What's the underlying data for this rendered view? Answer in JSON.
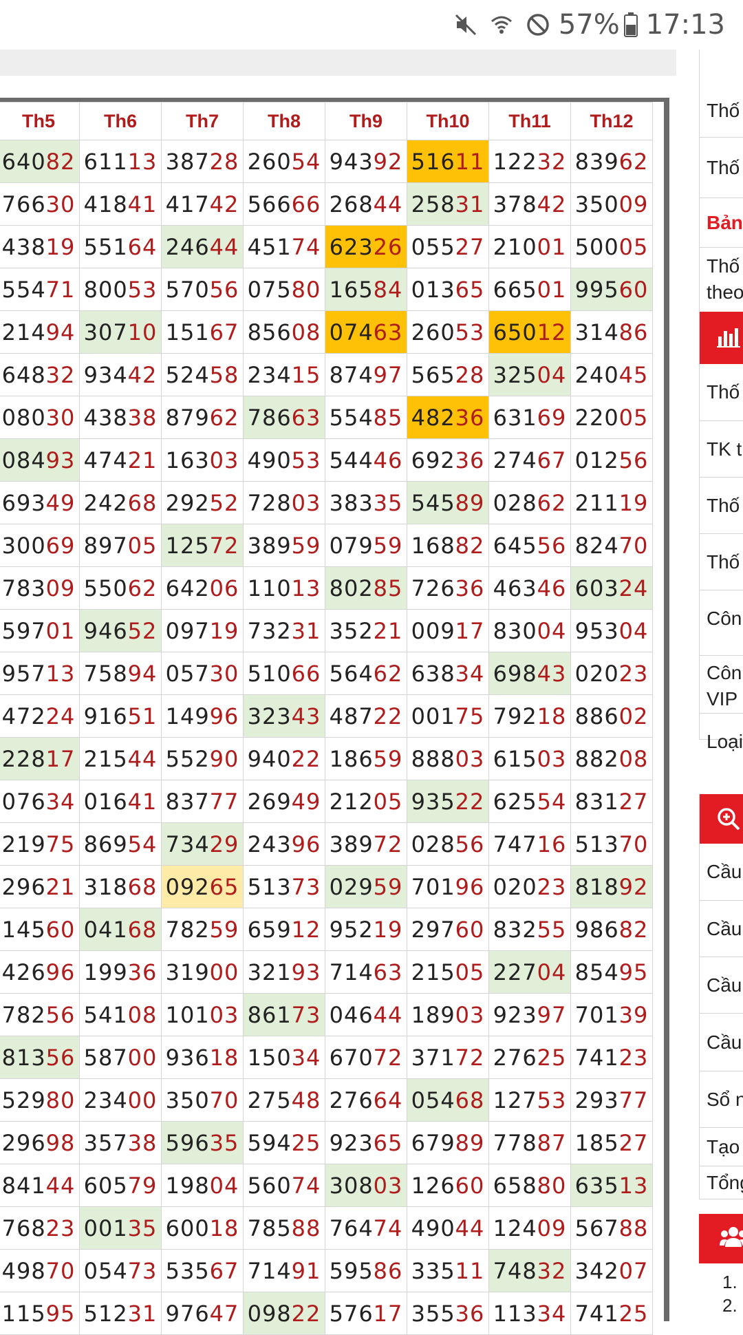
{
  "status_bar": {
    "battery": "57%",
    "time": "17:13",
    "icons": [
      "mute-icon",
      "wifi-icon",
      "do-not-disturb-icon",
      "battery-icon"
    ]
  },
  "table": {
    "headers": [
      "Th5",
      "Th6",
      "Th7",
      "Th8",
      "Th9",
      "Th10",
      "Th11",
      "Th12"
    ],
    "rows": [
      [
        [
          "640",
          "82",
          "green"
        ],
        [
          "611",
          "13",
          ""
        ],
        [
          "387",
          "28",
          ""
        ],
        [
          "260",
          "54",
          ""
        ],
        [
          "943",
          "92",
          ""
        ],
        [
          "516",
          "11",
          "orange"
        ],
        [
          "122",
          "32",
          ""
        ],
        [
          "839",
          "62",
          ""
        ]
      ],
      [
        [
          "766",
          "30",
          ""
        ],
        [
          "418",
          "41",
          ""
        ],
        [
          "417",
          "42",
          ""
        ],
        [
          "566",
          "66",
          ""
        ],
        [
          "268",
          "44",
          ""
        ],
        [
          "258",
          "31",
          "green"
        ],
        [
          "378",
          "42",
          ""
        ],
        [
          "350",
          "09",
          ""
        ]
      ],
      [
        [
          "438",
          "19",
          ""
        ],
        [
          "551",
          "64",
          ""
        ],
        [
          "246",
          "44",
          "green"
        ],
        [
          "451",
          "74",
          ""
        ],
        [
          "623",
          "26",
          "orange"
        ],
        [
          "055",
          "27",
          ""
        ],
        [
          "210",
          "01",
          ""
        ],
        [
          "500",
          "05",
          ""
        ]
      ],
      [
        [
          "554",
          "71",
          ""
        ],
        [
          "800",
          "53",
          ""
        ],
        [
          "570",
          "56",
          ""
        ],
        [
          "075",
          "80",
          ""
        ],
        [
          "165",
          "84",
          "green"
        ],
        [
          "013",
          "65",
          ""
        ],
        [
          "665",
          "01",
          ""
        ],
        [
          "995",
          "60",
          "green"
        ]
      ],
      [
        [
          "214",
          "94",
          ""
        ],
        [
          "307",
          "10",
          "green"
        ],
        [
          "151",
          "67",
          ""
        ],
        [
          "856",
          "08",
          ""
        ],
        [
          "074",
          "63",
          "orange"
        ],
        [
          "260",
          "53",
          ""
        ],
        [
          "650",
          "12",
          "orange"
        ],
        [
          "314",
          "86",
          ""
        ]
      ],
      [
        [
          "648",
          "32",
          ""
        ],
        [
          "934",
          "42",
          ""
        ],
        [
          "524",
          "58",
          ""
        ],
        [
          "234",
          "15",
          ""
        ],
        [
          "874",
          "97",
          ""
        ],
        [
          "565",
          "28",
          ""
        ],
        [
          "325",
          "04",
          "green"
        ],
        [
          "240",
          "45",
          ""
        ]
      ],
      [
        [
          "080",
          "30",
          ""
        ],
        [
          "438",
          "38",
          ""
        ],
        [
          "879",
          "62",
          ""
        ],
        [
          "786",
          "63",
          "green"
        ],
        [
          "554",
          "85",
          ""
        ],
        [
          "482",
          "36",
          "orange"
        ],
        [
          "631",
          "69",
          ""
        ],
        [
          "220",
          "05",
          ""
        ]
      ],
      [
        [
          "084",
          "93",
          "green"
        ],
        [
          "474",
          "21",
          ""
        ],
        [
          "163",
          "03",
          ""
        ],
        [
          "490",
          "53",
          ""
        ],
        [
          "544",
          "46",
          ""
        ],
        [
          "692",
          "36",
          ""
        ],
        [
          "274",
          "67",
          ""
        ],
        [
          "012",
          "56",
          ""
        ]
      ],
      [
        [
          "693",
          "49",
          ""
        ],
        [
          "242",
          "68",
          ""
        ],
        [
          "292",
          "52",
          ""
        ],
        [
          "728",
          "03",
          ""
        ],
        [
          "383",
          "35",
          ""
        ],
        [
          "545",
          "89",
          "green"
        ],
        [
          "028",
          "62",
          ""
        ],
        [
          "211",
          "19",
          ""
        ]
      ],
      [
        [
          "300",
          "69",
          ""
        ],
        [
          "897",
          "05",
          ""
        ],
        [
          "125",
          "72",
          "green"
        ],
        [
          "389",
          "59",
          ""
        ],
        [
          "079",
          "59",
          ""
        ],
        [
          "168",
          "82",
          ""
        ],
        [
          "645",
          "56",
          ""
        ],
        [
          "824",
          "70",
          ""
        ]
      ],
      [
        [
          "783",
          "09",
          ""
        ],
        [
          "550",
          "62",
          ""
        ],
        [
          "642",
          "06",
          ""
        ],
        [
          "110",
          "13",
          ""
        ],
        [
          "802",
          "85",
          "green"
        ],
        [
          "726",
          "36",
          ""
        ],
        [
          "463",
          "46",
          ""
        ],
        [
          "603",
          "24",
          "green"
        ]
      ],
      [
        [
          "597",
          "01",
          ""
        ],
        [
          "946",
          "52",
          "green"
        ],
        [
          "097",
          "19",
          ""
        ],
        [
          "732",
          "31",
          ""
        ],
        [
          "352",
          "21",
          ""
        ],
        [
          "009",
          "17",
          ""
        ],
        [
          "830",
          "04",
          ""
        ],
        [
          "953",
          "04",
          ""
        ]
      ],
      [
        [
          "957",
          "13",
          ""
        ],
        [
          "758",
          "94",
          ""
        ],
        [
          "057",
          "30",
          ""
        ],
        [
          "510",
          "66",
          ""
        ],
        [
          "564",
          "62",
          ""
        ],
        [
          "638",
          "34",
          ""
        ],
        [
          "698",
          "43",
          "green"
        ],
        [
          "020",
          "23",
          ""
        ]
      ],
      [
        [
          "472",
          "24",
          ""
        ],
        [
          "916",
          "51",
          ""
        ],
        [
          "149",
          "96",
          ""
        ],
        [
          "323",
          "43",
          "green"
        ],
        [
          "487",
          "22",
          ""
        ],
        [
          "001",
          "75",
          ""
        ],
        [
          "792",
          "18",
          ""
        ],
        [
          "886",
          "02",
          ""
        ]
      ],
      [
        [
          "228",
          "17",
          "green"
        ],
        [
          "215",
          "44",
          ""
        ],
        [
          "552",
          "90",
          ""
        ],
        [
          "940",
          "22",
          ""
        ],
        [
          "186",
          "59",
          ""
        ],
        [
          "888",
          "03",
          ""
        ],
        [
          "615",
          "03",
          ""
        ],
        [
          "882",
          "08",
          ""
        ]
      ],
      [
        [
          "076",
          "34",
          ""
        ],
        [
          "016",
          "41",
          ""
        ],
        [
          "837",
          "77",
          ""
        ],
        [
          "269",
          "49",
          ""
        ],
        [
          "212",
          "05",
          ""
        ],
        [
          "935",
          "22",
          "green"
        ],
        [
          "625",
          "54",
          ""
        ],
        [
          "831",
          "27",
          ""
        ]
      ],
      [
        [
          "219",
          "75",
          ""
        ],
        [
          "869",
          "54",
          ""
        ],
        [
          "734",
          "29",
          "green"
        ],
        [
          "243",
          "96",
          ""
        ],
        [
          "389",
          "72",
          ""
        ],
        [
          "028",
          "56",
          ""
        ],
        [
          "747",
          "16",
          ""
        ],
        [
          "513",
          "70",
          ""
        ]
      ],
      [
        [
          "296",
          "21",
          ""
        ],
        [
          "318",
          "68",
          ""
        ],
        [
          "092",
          "65",
          "yellow"
        ],
        [
          "513",
          "73",
          ""
        ],
        [
          "029",
          "59",
          "green"
        ],
        [
          "701",
          "96",
          ""
        ],
        [
          "020",
          "23",
          ""
        ],
        [
          "818",
          "92",
          "green"
        ]
      ],
      [
        [
          "145",
          "60",
          ""
        ],
        [
          "041",
          "68",
          "green"
        ],
        [
          "782",
          "59",
          ""
        ],
        [
          "659",
          "12",
          ""
        ],
        [
          "952",
          "19",
          ""
        ],
        [
          "297",
          "60",
          ""
        ],
        [
          "832",
          "55",
          ""
        ],
        [
          "986",
          "82",
          ""
        ]
      ],
      [
        [
          "426",
          "96",
          ""
        ],
        [
          "199",
          "36",
          ""
        ],
        [
          "319",
          "00",
          ""
        ],
        [
          "321",
          "93",
          ""
        ],
        [
          "714",
          "63",
          ""
        ],
        [
          "215",
          "05",
          ""
        ],
        [
          "227",
          "04",
          "green"
        ],
        [
          "854",
          "95",
          ""
        ]
      ],
      [
        [
          "782",
          "56",
          ""
        ],
        [
          "541",
          "08",
          ""
        ],
        [
          "101",
          "03",
          ""
        ],
        [
          "861",
          "73",
          "green"
        ],
        [
          "046",
          "44",
          ""
        ],
        [
          "189",
          "03",
          ""
        ],
        [
          "923",
          "97",
          ""
        ],
        [
          "701",
          "39",
          ""
        ]
      ],
      [
        [
          "813",
          "56",
          "green"
        ],
        [
          "587",
          "00",
          ""
        ],
        [
          "936",
          "18",
          ""
        ],
        [
          "150",
          "34",
          ""
        ],
        [
          "670",
          "72",
          ""
        ],
        [
          "371",
          "72",
          ""
        ],
        [
          "276",
          "25",
          ""
        ],
        [
          "741",
          "23",
          ""
        ]
      ],
      [
        [
          "529",
          "80",
          ""
        ],
        [
          "234",
          "00",
          ""
        ],
        [
          "350",
          "70",
          ""
        ],
        [
          "275",
          "48",
          ""
        ],
        [
          "276",
          "64",
          ""
        ],
        [
          "054",
          "68",
          "green"
        ],
        [
          "127",
          "53",
          ""
        ],
        [
          "293",
          "77",
          ""
        ]
      ],
      [
        [
          "296",
          "98",
          ""
        ],
        [
          "357",
          "38",
          ""
        ],
        [
          "596",
          "35",
          "green"
        ],
        [
          "594",
          "25",
          ""
        ],
        [
          "923",
          "65",
          ""
        ],
        [
          "679",
          "89",
          ""
        ],
        [
          "778",
          "87",
          ""
        ],
        [
          "185",
          "27",
          ""
        ]
      ],
      [
        [
          "841",
          "44",
          ""
        ],
        [
          "605",
          "79",
          ""
        ],
        [
          "198",
          "04",
          ""
        ],
        [
          "560",
          "74",
          ""
        ],
        [
          "308",
          "03",
          "green"
        ],
        [
          "126",
          "60",
          ""
        ],
        [
          "658",
          "80",
          ""
        ],
        [
          "635",
          "13",
          "green"
        ]
      ],
      [
        [
          "768",
          "23",
          ""
        ],
        [
          "001",
          "35",
          "green"
        ],
        [
          "600",
          "18",
          ""
        ],
        [
          "785",
          "88",
          ""
        ],
        [
          "764",
          "74",
          ""
        ],
        [
          "490",
          "44",
          ""
        ],
        [
          "124",
          "09",
          ""
        ],
        [
          "567",
          "88",
          ""
        ]
      ],
      [
        [
          "498",
          "70",
          ""
        ],
        [
          "054",
          "73",
          ""
        ],
        [
          "535",
          "67",
          ""
        ],
        [
          "714",
          "91",
          ""
        ],
        [
          "595",
          "86",
          ""
        ],
        [
          "335",
          "11",
          ""
        ],
        [
          "748",
          "32",
          "green"
        ],
        [
          "342",
          "07",
          ""
        ]
      ],
      [
        [
          "115",
          "95",
          ""
        ],
        [
          "512",
          "31",
          ""
        ],
        [
          "976",
          "47",
          ""
        ],
        [
          "098",
          "22",
          "green"
        ],
        [
          "576",
          "17",
          ""
        ],
        [
          "355",
          "36",
          ""
        ],
        [
          "113",
          "34",
          ""
        ],
        [
          "741",
          "25",
          ""
        ]
      ]
    ]
  },
  "sidebar": {
    "items_group1": [
      "Thố",
      "Thố"
    ],
    "section_title": "Bản",
    "items_group2": [
      "Thố theo"
    ],
    "items_group3": [
      "Thố",
      "TK t",
      "Thố",
      "Thố",
      "Côn",
      "Côn VIP",
      "Loại"
    ],
    "items_group4": [
      "Cầu",
      "Cầu",
      "Cầu",
      "Cầu",
      "Sổ n",
      "Tạo",
      "Tổng"
    ],
    "list_numbers": [
      "1.",
      "2."
    ],
    "icons": [
      "chart-icon",
      "zoom-icon",
      "users-icon"
    ],
    "accent_color": "#e31b23"
  },
  "colors": {
    "highlight_green": "#e1efd9",
    "highlight_orange": "#ffc106",
    "highlight_yellow": "#ffeba8",
    "tail_red": "#b01c1c"
  }
}
